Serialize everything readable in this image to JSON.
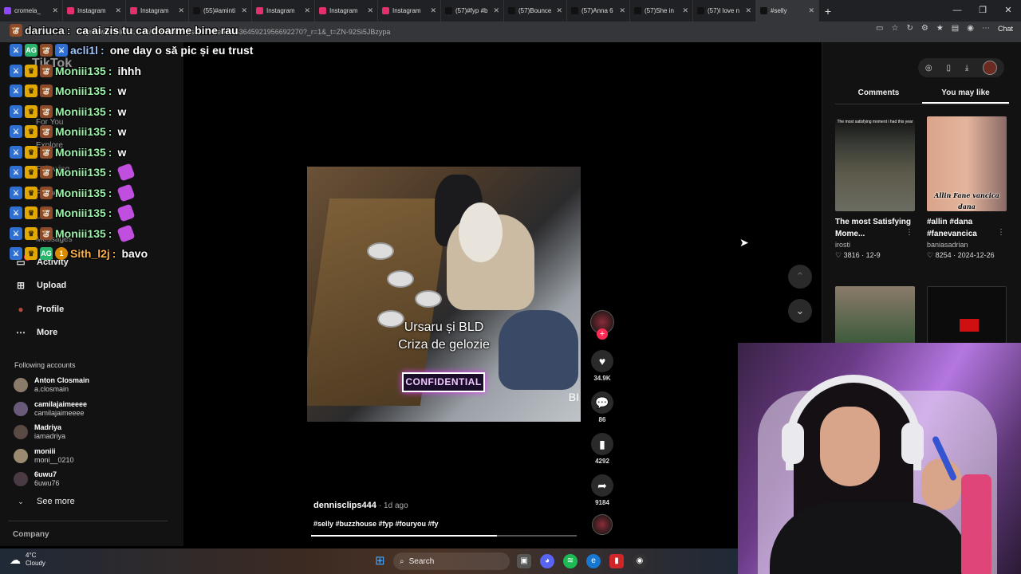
{
  "browser": {
    "tabs": [
      {
        "label": "cromela_",
        "icon": "twitch-icon",
        "color": "#9146ff",
        "active": false
      },
      {
        "label": "Instagram",
        "icon": "instagram-icon",
        "color": "#e1306c",
        "active": false
      },
      {
        "label": "Instagram",
        "icon": "instagram-icon",
        "color": "#e1306c",
        "active": false
      },
      {
        "label": "(55)#aminti",
        "icon": "tiktok-icon",
        "color": "#111",
        "active": false
      },
      {
        "label": "Instagram",
        "icon": "instagram-icon",
        "color": "#e1306c",
        "active": false
      },
      {
        "label": "Instagram",
        "icon": "instagram-icon",
        "color": "#e1306c",
        "active": false
      },
      {
        "label": "Instagram",
        "icon": "instagram-icon",
        "color": "#e1306c",
        "active": false
      },
      {
        "label": "(57)#fyp #b",
        "icon": "tiktok-icon",
        "color": "#111",
        "active": false
      },
      {
        "label": "(57)Bounce",
        "icon": "tiktok-icon",
        "color": "#111",
        "active": false
      },
      {
        "label": "(57)Anna 6",
        "icon": "tiktok-icon",
        "color": "#111",
        "active": false
      },
      {
        "label": "(57)She in",
        "icon": "tiktok-icon",
        "color": "#111",
        "active": false
      },
      {
        "label": "(57)I love n",
        "icon": "tiktok-icon",
        "color": "#111",
        "active": false
      },
      {
        "label": "#selly",
        "icon": "tiktok-icon",
        "color": "#111",
        "active": true
      }
    ],
    "url": "https://www.tiktok.com/@dennisclips444/video/7453645921956692270?_r=1&_t=ZN-92Si5JBzypa",
    "chat_label": "Chat"
  },
  "chat": [
    {
      "name": "dariuca",
      "color": "#e8e8e8",
      "badges": [
        "cow"
      ],
      "message": "ca ai zis tu ca doarme bine rau",
      "emote": false
    },
    {
      "name": "acli1l",
      "color": "#9ec5ff",
      "badges": [
        "blue",
        "green",
        "cow",
        "blue"
      ],
      "message": "one day o să pic și eu trust",
      "emote": false
    },
    {
      "name": "Moniii135",
      "color": "#9cf2a8",
      "badges": [
        "blue",
        "crown",
        "cow"
      ],
      "message": "ihhh",
      "emote": false
    },
    {
      "name": "Moniii135",
      "color": "#9cf2a8",
      "badges": [
        "blue",
        "crown",
        "cow"
      ],
      "message": "w",
      "emote": false
    },
    {
      "name": "Moniii135",
      "color": "#9cf2a8",
      "badges": [
        "blue",
        "crown",
        "cow"
      ],
      "message": "w",
      "emote": false
    },
    {
      "name": "Moniii135",
      "color": "#9cf2a8",
      "badges": [
        "blue",
        "crown",
        "cow"
      ],
      "message": "w",
      "emote": false
    },
    {
      "name": "Moniii135",
      "color": "#9cf2a8",
      "badges": [
        "blue",
        "crown",
        "cow"
      ],
      "message": "w",
      "emote": false
    },
    {
      "name": "Moniii135",
      "color": "#9cf2a8",
      "badges": [
        "blue",
        "crown",
        "cow"
      ],
      "message": "",
      "emote": true
    },
    {
      "name": "Moniii135",
      "color": "#9cf2a8",
      "badges": [
        "blue",
        "crown",
        "cow"
      ],
      "message": "",
      "emote": true
    },
    {
      "name": "Moniii135",
      "color": "#9cf2a8",
      "badges": [
        "blue",
        "crown",
        "cow"
      ],
      "message": "",
      "emote": true
    },
    {
      "name": "Moniii135",
      "color": "#9cf2a8",
      "badges": [
        "blue",
        "crown",
        "cow"
      ],
      "message": "",
      "emote": true
    },
    {
      "name": "Sith_l2j",
      "color": "#ffb347",
      "badges": [
        "blue",
        "crown",
        "green",
        "sub"
      ],
      "message": "bavo",
      "emote": false
    }
  ],
  "nav": {
    "ghost_items": [
      "TikTok",
      "For You",
      "Explore",
      "Following",
      "Friends",
      "LIVE",
      "Messages"
    ],
    "activity": "Activity",
    "activity_badge": "3",
    "upload": "Upload",
    "profile": "Profile",
    "more": "More",
    "following_title": "Following accounts",
    "accounts": [
      {
        "name": "Anton Closmain",
        "handle": "a.closmain"
      },
      {
        "name": "camilajaimeeee",
        "handle": "camilajaimeeee"
      },
      {
        "name": "Madriya",
        "handle": "iamadriya"
      },
      {
        "name": "moniii",
        "handle": "moni__0210"
      },
      {
        "name": "6uwu7",
        "handle": "6uwu76"
      }
    ],
    "see_more": "See more",
    "company": "Company"
  },
  "video": {
    "caption_line1": "Ursaru și BLD",
    "caption_line2": "Criza de gelozie",
    "confidential": "CONFIDENTIAL",
    "edge_text": "BI",
    "author": "dennisclips444",
    "ago": "· 1d ago",
    "hashtags": "#selly #buzzhouse #fyp #fouryou #fy",
    "progress": 0.7,
    "likes": "34.9K",
    "comments": "86",
    "saves": "4292",
    "shares": "9184"
  },
  "panel": {
    "tab_comments": "Comments",
    "tab_you_may_like": "You may like",
    "cards": [
      {
        "title": "The most Satisfying Mome...",
        "user": "irosti",
        "likes": "3816",
        "date": "12-9",
        "thumb_label": "The most satisfying moment i had this year",
        "overlay": ""
      },
      {
        "title": "#allin #dana #fanevancica",
        "user": "baniasadrian",
        "likes": "8254",
        "date": "2024-12-26",
        "thumb_label": "",
        "overlay": "Allin Fane vancica dana"
      }
    ]
  },
  "taskbar": {
    "temperature": "4°C",
    "condition": "Cloudy",
    "search_label": "Search"
  }
}
